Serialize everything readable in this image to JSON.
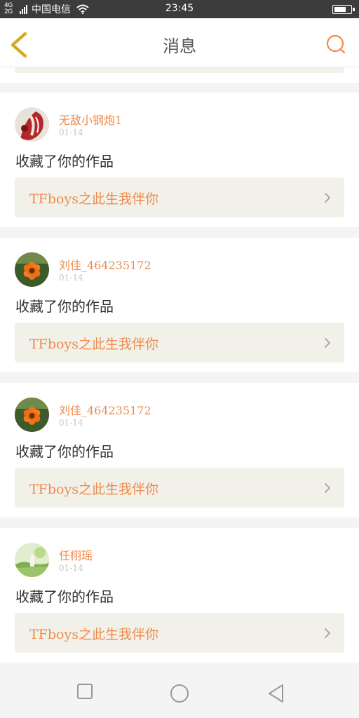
{
  "status_bar": {
    "signal_text_top": "4G",
    "signal_text_bottom": "2G",
    "carrier": "中国电信",
    "time": "23:45",
    "battery_level": 0.75,
    "icons": [
      "signal-icon",
      "wifi-icon",
      "battery-icon"
    ]
  },
  "nav": {
    "title": "消息",
    "back_icon": "chevron-left-icon",
    "search_icon": "search-icon",
    "back_color": "#e8c23a",
    "accent_color": "#f08a4b"
  },
  "messages": [
    {
      "user": "无敌小钢炮1",
      "time": "01-14",
      "action": "收藏了你的作品",
      "work": "TFboys之此生我伴你",
      "avatar": "avatar-red-art"
    },
    {
      "user": "刘佳_464235172",
      "time": "01-14",
      "action": "收藏了你的作品",
      "work": "TFboys之此生我伴你",
      "avatar": "avatar-orange-flower"
    },
    {
      "user": "刘佳_464235172",
      "time": "01-14",
      "action": "收藏了你的作品",
      "work": "TFboys之此生我伴你",
      "avatar": "avatar-orange-flower"
    },
    {
      "user": "任栩瑶",
      "time": "01-14",
      "action": "收藏了你的作品",
      "work": "TFboys之此生我伴你",
      "avatar": "avatar-green-landscape"
    }
  ],
  "system_nav": {
    "icons": [
      "recent-apps-icon",
      "home-icon",
      "back-triangle-icon"
    ]
  }
}
